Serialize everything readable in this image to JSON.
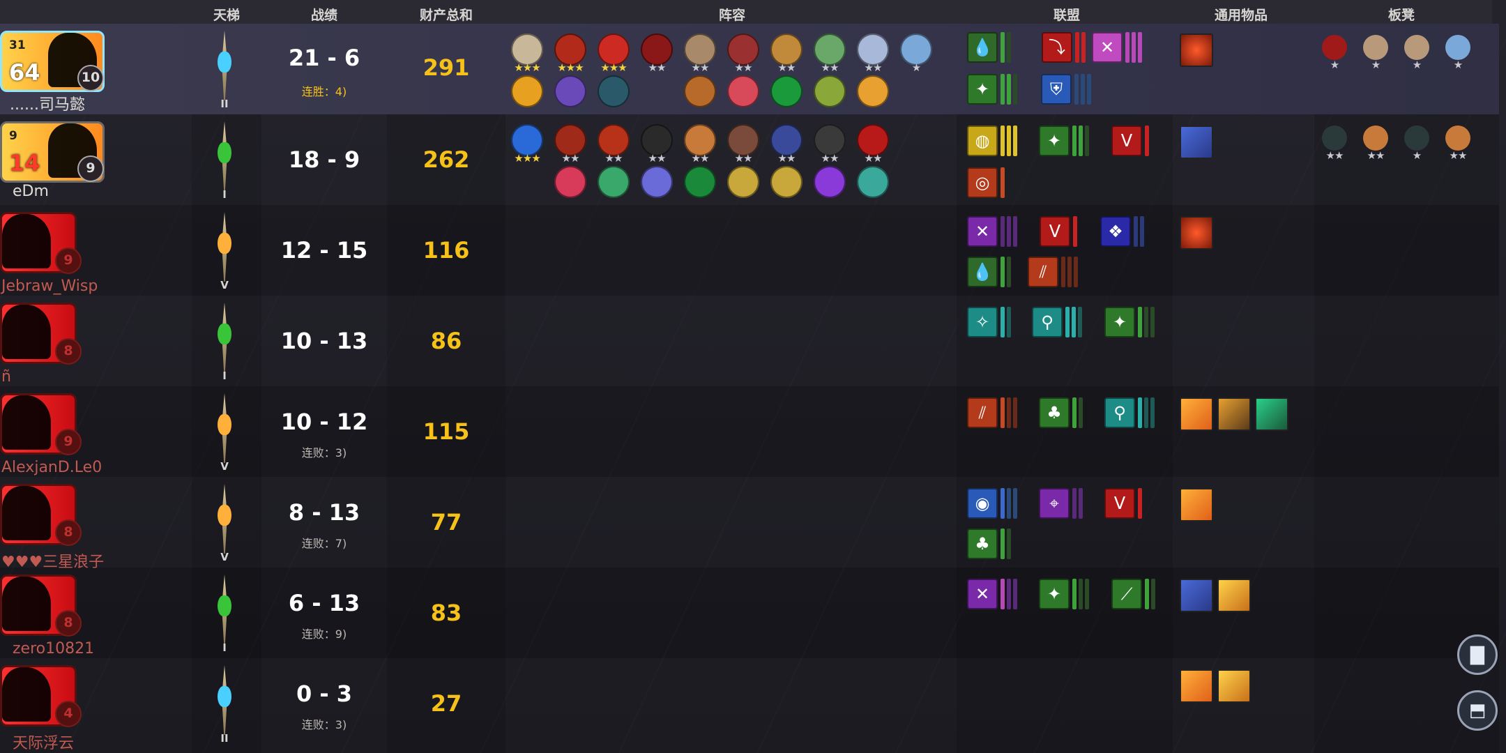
{
  "headers": {
    "rank": "天梯",
    "record": "战绩",
    "networth": "财产总和",
    "lineup": "阵容",
    "alliances": "联盟",
    "items": "通用物品",
    "bench": "板凳"
  },
  "players": [
    {
      "name": "......司马懿",
      "gold": "31",
      "hp": "64",
      "level": "10",
      "rank_tier": "II",
      "record": "21 - 6",
      "streak": "连胜：4)",
      "networth": "291"
    },
    {
      "name": "eDm",
      "gold": "9",
      "hp": "14",
      "level": "9",
      "rank_tier": "I",
      "record": "18 - 9",
      "streak": "",
      "networth": "262"
    },
    {
      "name": "Jebraw_Wisp",
      "level": "9",
      "rank_tier": "V",
      "record": "12 - 15",
      "streak": "",
      "networth": "116"
    },
    {
      "name": "ñ",
      "level": "8",
      "rank_tier": "I",
      "record": "10 - 13",
      "streak": "",
      "networth": "86"
    },
    {
      "name": "AlexjanD.Le0",
      "level": "9",
      "rank_tier": "V",
      "record": "10 - 12",
      "streak": "连败：3)",
      "networth": "115"
    },
    {
      "name": "♥♥♥三星浪子",
      "level": "8",
      "rank_tier": "V",
      "record": "8 - 13",
      "streak": "连败：7)",
      "networth": "77"
    },
    {
      "name": "zero10821",
      "level": "8",
      "rank_tier": "I",
      "record": "6 - 13",
      "streak": "连败：9)",
      "networth": "83"
    },
    {
      "name": "天际浮云",
      "level": "4",
      "rank_tier": "II",
      "record": "0 - 3",
      "streak": "连败：3)",
      "networth": "27"
    }
  ],
  "icons": {
    "stats_button": "bar-chart-icon",
    "collapse_button": "scoreboard-toggle-icon"
  },
  "colors": {
    "networth": "#f6c21a",
    "alliance_green": "#2f7a2a",
    "alliance_red": "#b31b1b",
    "alliance_purple": "#7a2aa8",
    "alliance_teal": "#1e8c86"
  }
}
